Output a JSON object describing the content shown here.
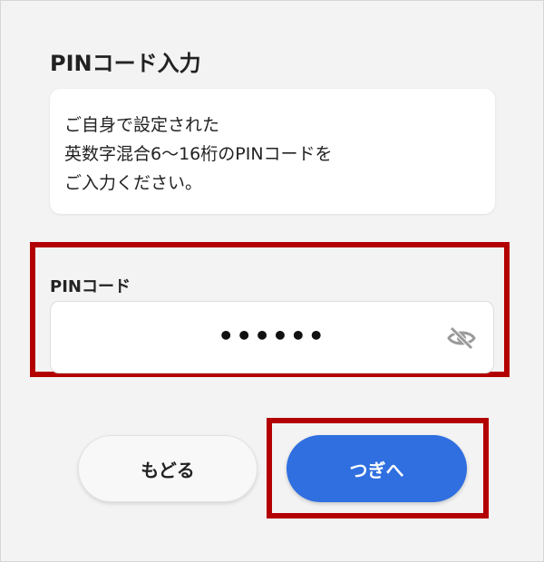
{
  "page": {
    "title": "PINコード入力"
  },
  "info": {
    "lines": [
      "ご自身で設定された",
      "英数字混合6〜16桁のPINコードを",
      "ご入力ください。"
    ]
  },
  "pin": {
    "label": "PINコード",
    "value": "••••••",
    "toggle_icon": "eye-slash-icon"
  },
  "actions": {
    "back_label": "もどる",
    "next_label": "つぎへ"
  },
  "colors": {
    "accent": "#2f6fe0",
    "highlight": "#b30000",
    "background": "#f3f3f3"
  }
}
